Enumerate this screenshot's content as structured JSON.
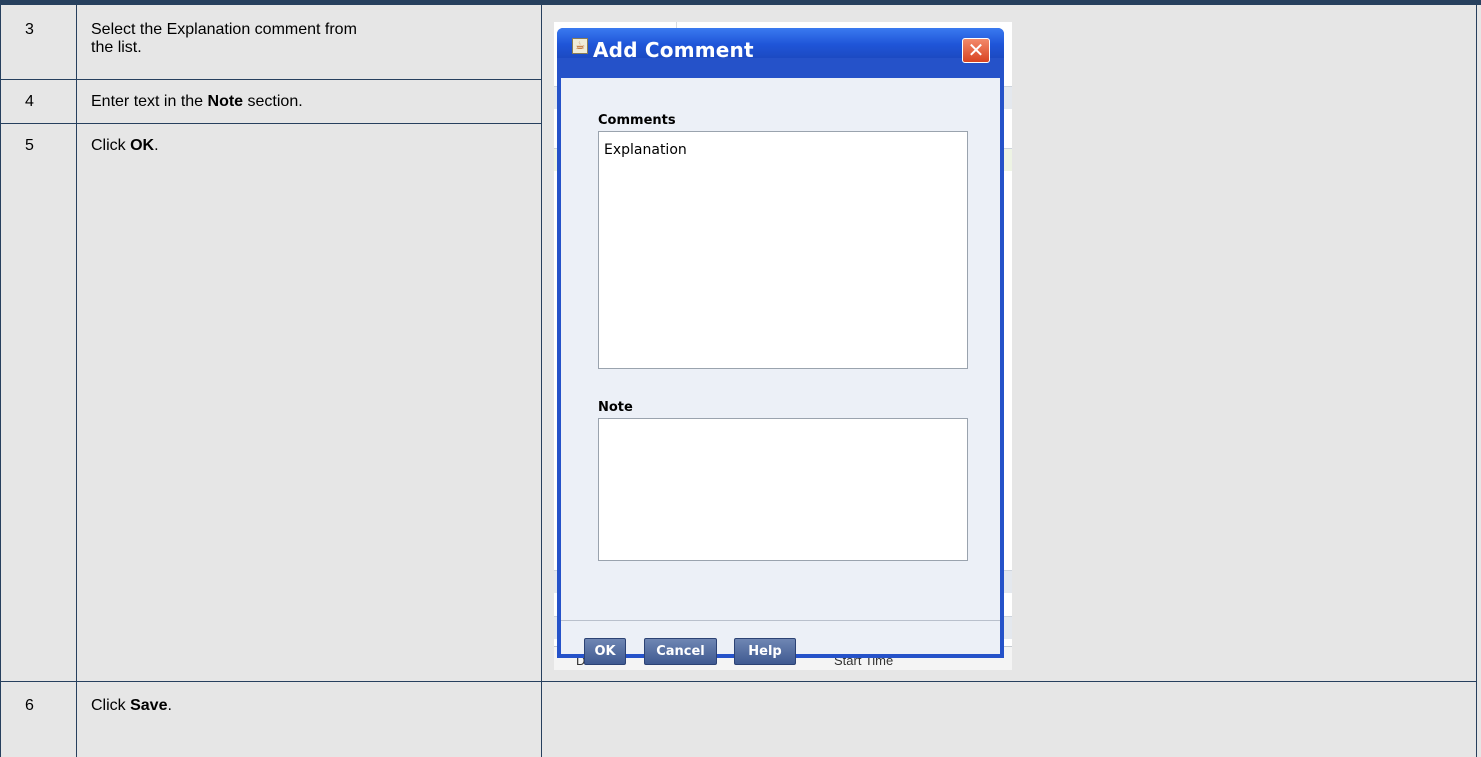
{
  "steps": [
    {
      "num": "3",
      "text_line1": "Select the Explanation comment from",
      "text_line2": "the list."
    },
    {
      "num": "4",
      "text_pre": "Enter text in the ",
      "text_bold": "Note",
      "text_post": " section."
    },
    {
      "num": "5",
      "text_pre": "Click ",
      "text_bold": "OK",
      "text_post": "."
    },
    {
      "num": "6",
      "text_pre": "Click ",
      "text_bold": "Save",
      "text_post": "."
    }
  ],
  "dialog": {
    "title": "Add Comment",
    "comments_label": "Comments",
    "comments_items": [
      "Explanation"
    ],
    "note_label": "Note",
    "note_value": "",
    "buttons": {
      "ok": "OK",
      "cancel": "Cancel",
      "help": "Help"
    }
  },
  "background_screen": {
    "footer_columns": [
      "Date",
      "Start Time"
    ]
  },
  "colors": {
    "border": "#27405e",
    "page_background": "#e6e6e6",
    "dialog_title": "#1f55d8"
  }
}
